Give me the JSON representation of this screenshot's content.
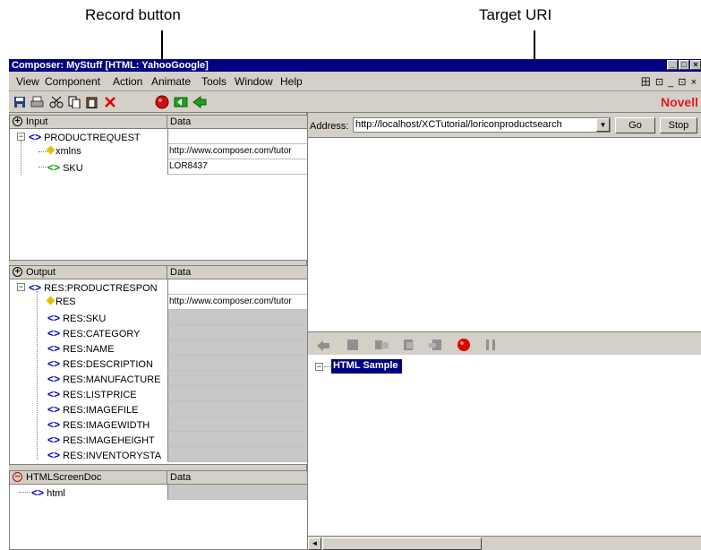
{
  "callouts": {
    "record": "Record button",
    "target": "Target URI"
  },
  "window": {
    "title": "Composer: MyStuff [HTML: YahooGoogle]",
    "controls": [
      "_",
      "□",
      "×"
    ]
  },
  "menu": {
    "items": [
      "View",
      "Component",
      "Action",
      "Animate",
      "Tools",
      "Window",
      "Help"
    ],
    "right_controls": "田 ⊡  _ ⊡ ×"
  },
  "toolbar": {
    "brand": "Novell"
  },
  "input_tree": {
    "header_left": "Input",
    "header_right": "Data",
    "rows": [
      {
        "label": "PRODUCTREQUEST",
        "data": ""
      },
      {
        "label": "xmlns",
        "data": "http://www.composer.com/tutor"
      },
      {
        "label": "SKU",
        "data": "LOR8437"
      }
    ]
  },
  "output_tree": {
    "header_left": "Output",
    "header_right": "Data",
    "rows": [
      {
        "label": "RES:PRODUCTRESPON",
        "data": ""
      },
      {
        "label": "RES",
        "data": "http://www.composer.com/tutor"
      },
      {
        "label": "RES:SKU",
        "data": ""
      },
      {
        "label": "RES:CATEGORY",
        "data": ""
      },
      {
        "label": "RES:NAME",
        "data": ""
      },
      {
        "label": "RES:DESCRIPTION",
        "data": ""
      },
      {
        "label": "RES:MANUFACTURE",
        "data": ""
      },
      {
        "label": "RES:LISTPRICE",
        "data": ""
      },
      {
        "label": "RES:IMAGEFILE",
        "data": ""
      },
      {
        "label": "RES:IMAGEWIDTH",
        "data": ""
      },
      {
        "label": "RES:IMAGEHEIGHT",
        "data": ""
      },
      {
        "label": "RES:INVENTORYSTA",
        "data": ""
      }
    ]
  },
  "screen_tree": {
    "header_left": "HTMLScreenDoc",
    "header_right": "Data",
    "rows": [
      {
        "label": "html",
        "data": ""
      }
    ]
  },
  "browser": {
    "address_label": "Address:",
    "address_value": "http://localhost/XCTutorial/loriconproductsearch",
    "go_label": "Go",
    "stop_label": "Stop"
  },
  "sample": {
    "node_label": "HTML Sample"
  }
}
